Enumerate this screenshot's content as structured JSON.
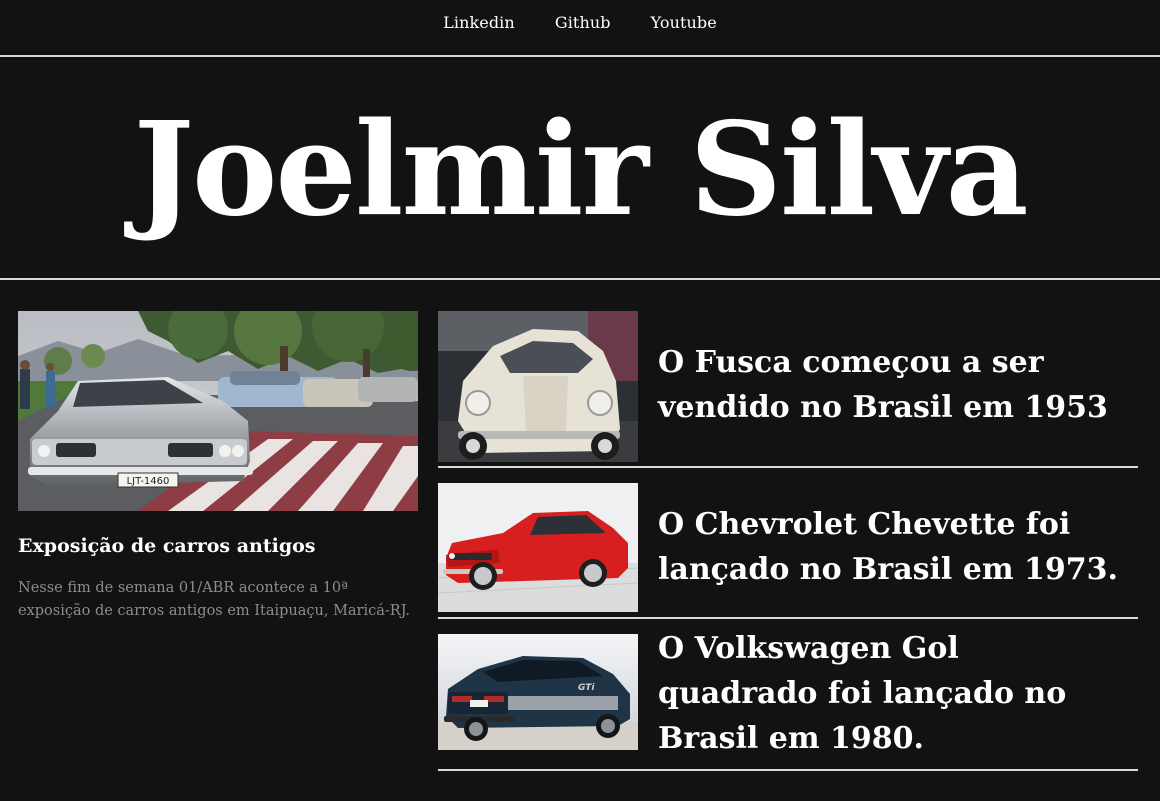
{
  "nav": {
    "links": [
      {
        "label": "Linkedin"
      },
      {
        "label": "Github"
      },
      {
        "label": "Youtube"
      }
    ]
  },
  "hero": {
    "title": "Joelmir Silva"
  },
  "feature": {
    "image_subject": "classic cars parked at an outdoor exhibition",
    "image_plate": "LJT-1460",
    "title": "Exposição de carros antigos",
    "body": "Nesse fim de semana 01/ABR acontece a 10ª exposição de carros antigos em Itaipuaçu, Maricá-RJ."
  },
  "stories": [
    {
      "image_subject": "white Volkswagen Fusca",
      "headline": "O Fusca começou a ser vendido no Brasil em 1953"
    },
    {
      "image_subject": "red Chevrolet Chevette",
      "headline": "O Chevrolet Chevette foi lançado no Brasil em 1973."
    },
    {
      "image_subject": "dark blue Volkswagen Gol GTi",
      "image_badge": "GTi",
      "headline": "O Volkswagen Gol quadrado foi lançado no Brasil em 1980."
    }
  ],
  "colors": {
    "background": "#121212",
    "text": "#ffffff",
    "muted_text": "#8d8d8d",
    "divider": "#d9d9d9"
  }
}
